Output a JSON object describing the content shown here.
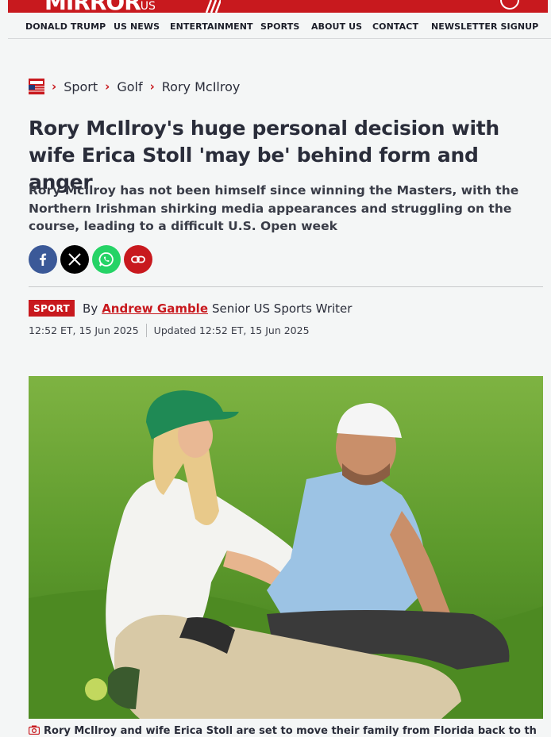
{
  "brand": {
    "logo_text": "MIRROR",
    "logo_suffix": "US",
    "accent": "#c8191e"
  },
  "nav": {
    "items": [
      "DONALD TRUMP",
      "US NEWS",
      "ENTERTAINMENT",
      "SPORTS",
      "ABOUT US",
      "CONTACT",
      "NEWSLETTER SIGNUP"
    ]
  },
  "breadcrumb": {
    "items": [
      "Sport",
      "Golf",
      "Rory McIlroy"
    ]
  },
  "article": {
    "headline": "Rory McIlroy's huge personal decision with wife Erica Stoll 'may be' behind form and anger",
    "standfirst": "Rory McIlroy has not been himself since winning the Masters, with the Northern Irishman shirking media appearances and struggling on the course, leading to a difficult U.S. Open week",
    "section_tag": "SPORT",
    "byline_prefix": "By",
    "author": "Andrew Gamble",
    "author_title": "Senior US Sports Writer",
    "published": "12:52 ET, 15 Jun 2025",
    "updated": "Updated 12:52 ET, 15 Jun 2025",
    "caption": "Rory McIlroy and wife Erica Stoll are set to move their family from Florida back to the"
  },
  "share": {
    "buttons": [
      {
        "name": "facebook-icon",
        "color": "#3b5998"
      },
      {
        "name": "x-icon",
        "color": "#000000"
      },
      {
        "name": "whatsapp-icon",
        "color": "#25d366"
      },
      {
        "name": "link-icon",
        "color": "#c8191e"
      }
    ]
  }
}
